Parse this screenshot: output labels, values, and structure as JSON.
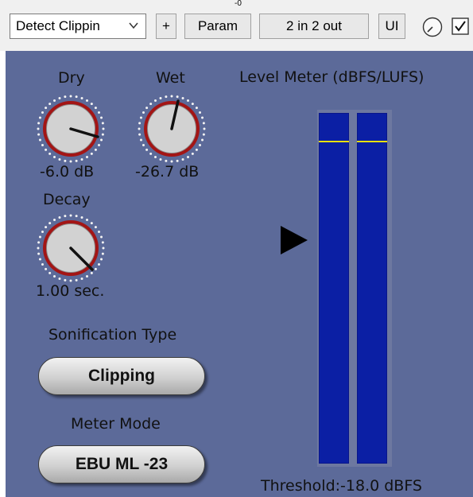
{
  "toolbar": {
    "preset": "Detect Clippin",
    "add_label": "+",
    "param_label": "Param",
    "io_label": "2 in 2 out",
    "ui_label": "UI",
    "tick_mark": "-0",
    "enabled": true
  },
  "panel": {
    "background_color": "#5c6a99",
    "dry": {
      "label": "Dry",
      "value_text": "-6.0  dB"
    },
    "wet": {
      "label": "Wet",
      "value_text": "-26.7 dB"
    },
    "decay": {
      "label": "Decay",
      "value_text": "1.00 sec."
    },
    "sonification": {
      "label": "Sonification Type",
      "value": "Clipping"
    },
    "meter_mode": {
      "label": "Meter Mode",
      "value": "EBU ML -23"
    },
    "meter": {
      "title": "Level Meter (dBFS/LUFS)",
      "threshold_text": "Threshold:-18.0 dBFS",
      "bar_color": "#0b1fa4",
      "threshold_color": "#e8e000",
      "threshold_fraction": 0.08
    }
  }
}
